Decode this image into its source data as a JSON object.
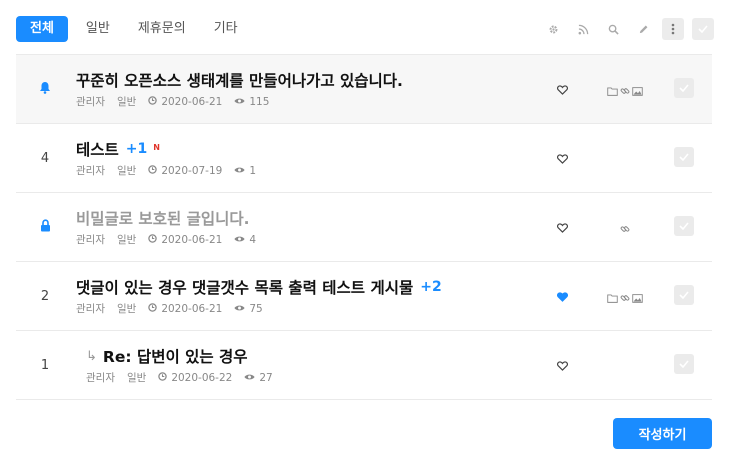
{
  "tabs": [
    {
      "label": "전체",
      "active": true
    },
    {
      "label": "일반",
      "active": false
    },
    {
      "label": "제휴문의",
      "active": false
    },
    {
      "label": "기타",
      "active": false
    }
  ],
  "toolbar_icons": [
    "gear-icon",
    "rss-icon",
    "search-icon",
    "pencil-icon",
    "more-icon",
    "check-icon"
  ],
  "posts": [
    {
      "num": "",
      "num_icon": "bell-icon",
      "notice": true,
      "title": "꾸준히 오픈소스 생태계를 만들어나가고 있습니다.",
      "comments": "",
      "is_new": false,
      "secret": false,
      "reply": false,
      "author": "관리자",
      "category": "일반",
      "date": "2020-06-21",
      "views": "115",
      "liked": false,
      "attachments": [
        "folder-icon",
        "link-icon",
        "image-icon"
      ]
    },
    {
      "num": "4",
      "notice": false,
      "title": "테스트",
      "comments": "+1",
      "is_new": true,
      "new_label": "N",
      "secret": false,
      "reply": false,
      "author": "관리자",
      "category": "일반",
      "date": "2020-07-19",
      "views": "1",
      "liked": false,
      "attachments": []
    },
    {
      "num": "",
      "num_icon": "lock-icon",
      "notice": false,
      "title": "비밀글로 보호된 글입니다.",
      "comments": "",
      "is_new": false,
      "secret": true,
      "reply": false,
      "author": "관리자",
      "category": "일반",
      "date": "2020-06-21",
      "views": "4",
      "liked": false,
      "attachments": [
        "link-icon"
      ]
    },
    {
      "num": "2",
      "notice": false,
      "title": "댓글이 있는 경우 댓글갯수 목록 출력 테스트 게시물",
      "comments": "+2",
      "is_new": false,
      "secret": false,
      "reply": false,
      "author": "관리자",
      "category": "일반",
      "date": "2020-06-21",
      "views": "75",
      "liked": true,
      "attachments": [
        "folder-icon",
        "link-icon",
        "image-icon"
      ]
    },
    {
      "num": "1",
      "notice": false,
      "title": "Re: 답변이 있는 경우",
      "comments": "",
      "is_new": false,
      "secret": false,
      "reply": true,
      "author": "관리자",
      "category": "일반",
      "date": "2020-06-22",
      "views": "27",
      "liked": false,
      "attachments": []
    }
  ],
  "write_button": "작성하기",
  "colors": {
    "accent": "#1a8cff",
    "new_badge": "#e0352b",
    "notice_bg": "#f7f7f7",
    "check_box": "#ebebeb"
  }
}
